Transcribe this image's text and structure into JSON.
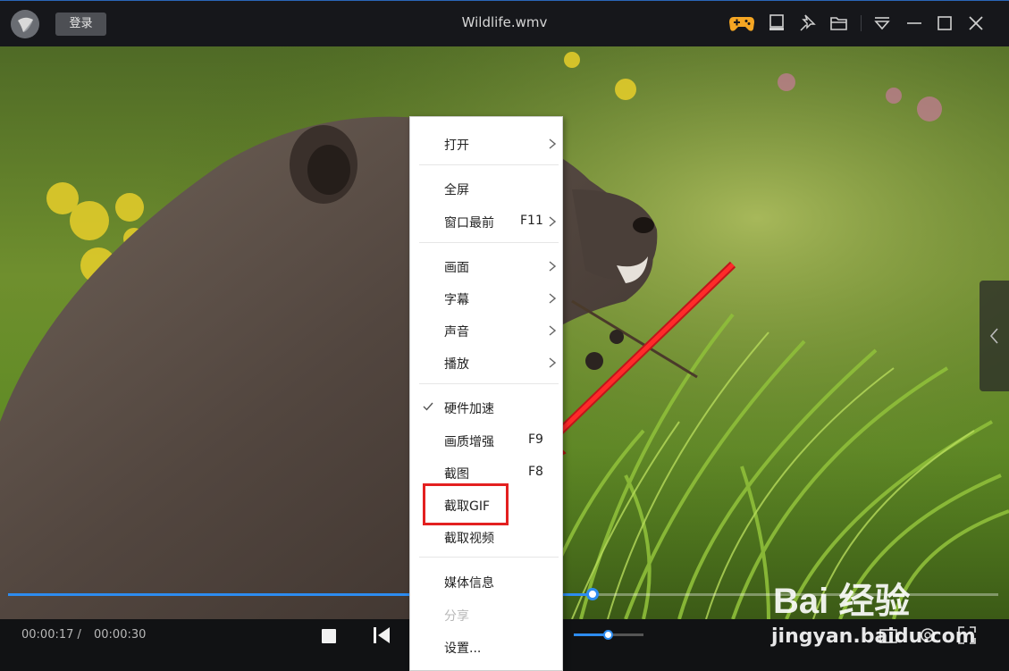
{
  "titlebar": {
    "login_label": "登录",
    "file_title": "Wildlife.wmv",
    "icons": [
      "game-icon",
      "mini-mode-icon",
      "pin-icon",
      "folder-icon",
      "menu-dropdown-icon",
      "minimize-icon",
      "maximize-icon",
      "close-icon"
    ]
  },
  "playback": {
    "current_time": "00:00:17 /",
    "total_time": "00:00:30",
    "progress_fraction": 0.59,
    "volume_fraction": 0.49
  },
  "context_menu": {
    "items": [
      {
        "label": "打开",
        "shortcut": "",
        "submenu": true
      },
      {
        "label": "全屏",
        "shortcut": "",
        "submenu": false
      },
      {
        "label": "窗口最前",
        "shortcut": "F11",
        "submenu": true
      },
      {
        "label": "画面",
        "shortcut": "",
        "submenu": true
      },
      {
        "label": "字幕",
        "shortcut": "",
        "submenu": true
      },
      {
        "label": "声音",
        "shortcut": "",
        "submenu": true
      },
      {
        "label": "播放",
        "shortcut": "",
        "submenu": true
      },
      {
        "label": "硬件加速",
        "shortcut": "",
        "checked": true
      },
      {
        "label": "画质增强",
        "shortcut": "F9"
      },
      {
        "label": "截图",
        "shortcut": "F8"
      },
      {
        "label": "截取GIF",
        "shortcut": ""
      },
      {
        "label": "截取视频",
        "shortcut": ""
      },
      {
        "label": "媒体信息",
        "shortcut": ""
      },
      {
        "label": "分享",
        "shortcut": "",
        "disabled": true
      },
      {
        "label": "设置...",
        "shortcut": ""
      }
    ]
  },
  "watermark": {
    "brand": "Bai 经验",
    "url": "jingyan.baidu.com"
  },
  "colors": {
    "accent": "#2d8cf0",
    "annotation": "#e32020",
    "titlebar_bg": "#16171b"
  }
}
